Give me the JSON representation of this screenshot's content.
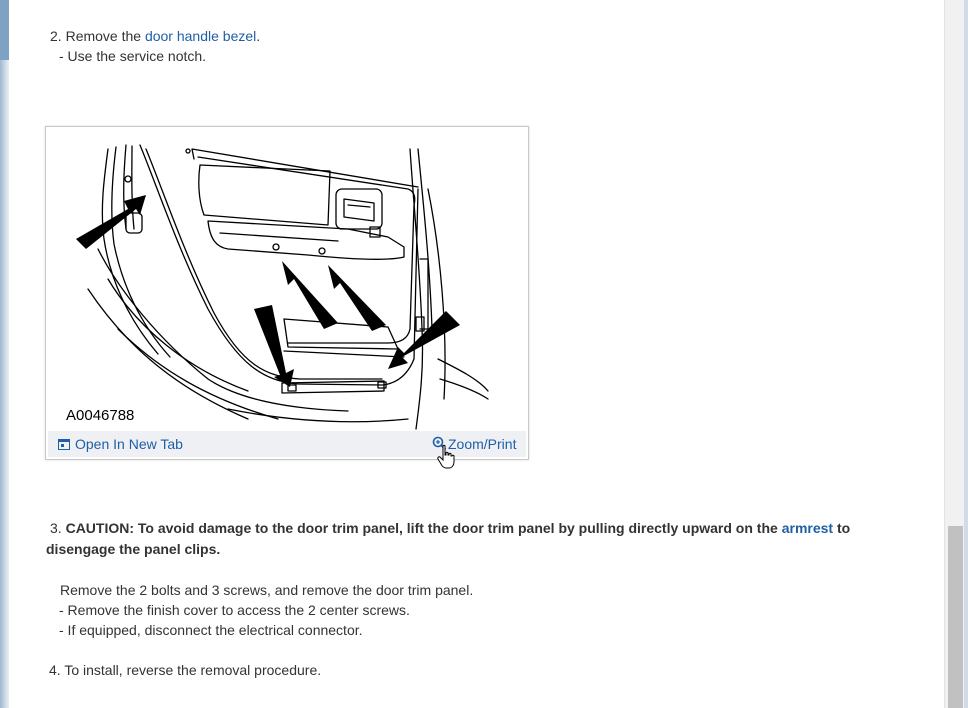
{
  "step2": {
    "number": "2.",
    "text_prefix": "Remove the",
    "link": "door handle bezel",
    "text_suffix": ".",
    "substeps": [
      "-  Use the service notch."
    ]
  },
  "figure": {
    "image_label": "A0046788",
    "open_new_tab": "Open In New Tab",
    "zoom_print": "Zoom/Print"
  },
  "step3": {
    "number": "3.",
    "caution_label": "CAUTION:",
    "caution_text_1": "To avoid damage to the door trim panel, lift the door trim panel by pulling directly upward on the",
    "caution_link": "armrest",
    "caution_text_2": "to disengage the panel clips.",
    "instruction": "Remove the 2 bolts and 3 screws, and remove the door trim panel.",
    "substeps": [
      "-  Remove the finish cover to access the 2 center screws.",
      "-  If equipped, disconnect the electrical connector."
    ]
  },
  "step4": {
    "number": "4.",
    "text": "To install, reverse the removal procedure."
  },
  "colors": {
    "link": "#1f5fa6",
    "text": "#333333",
    "figure_footer": "#eef0f3"
  }
}
